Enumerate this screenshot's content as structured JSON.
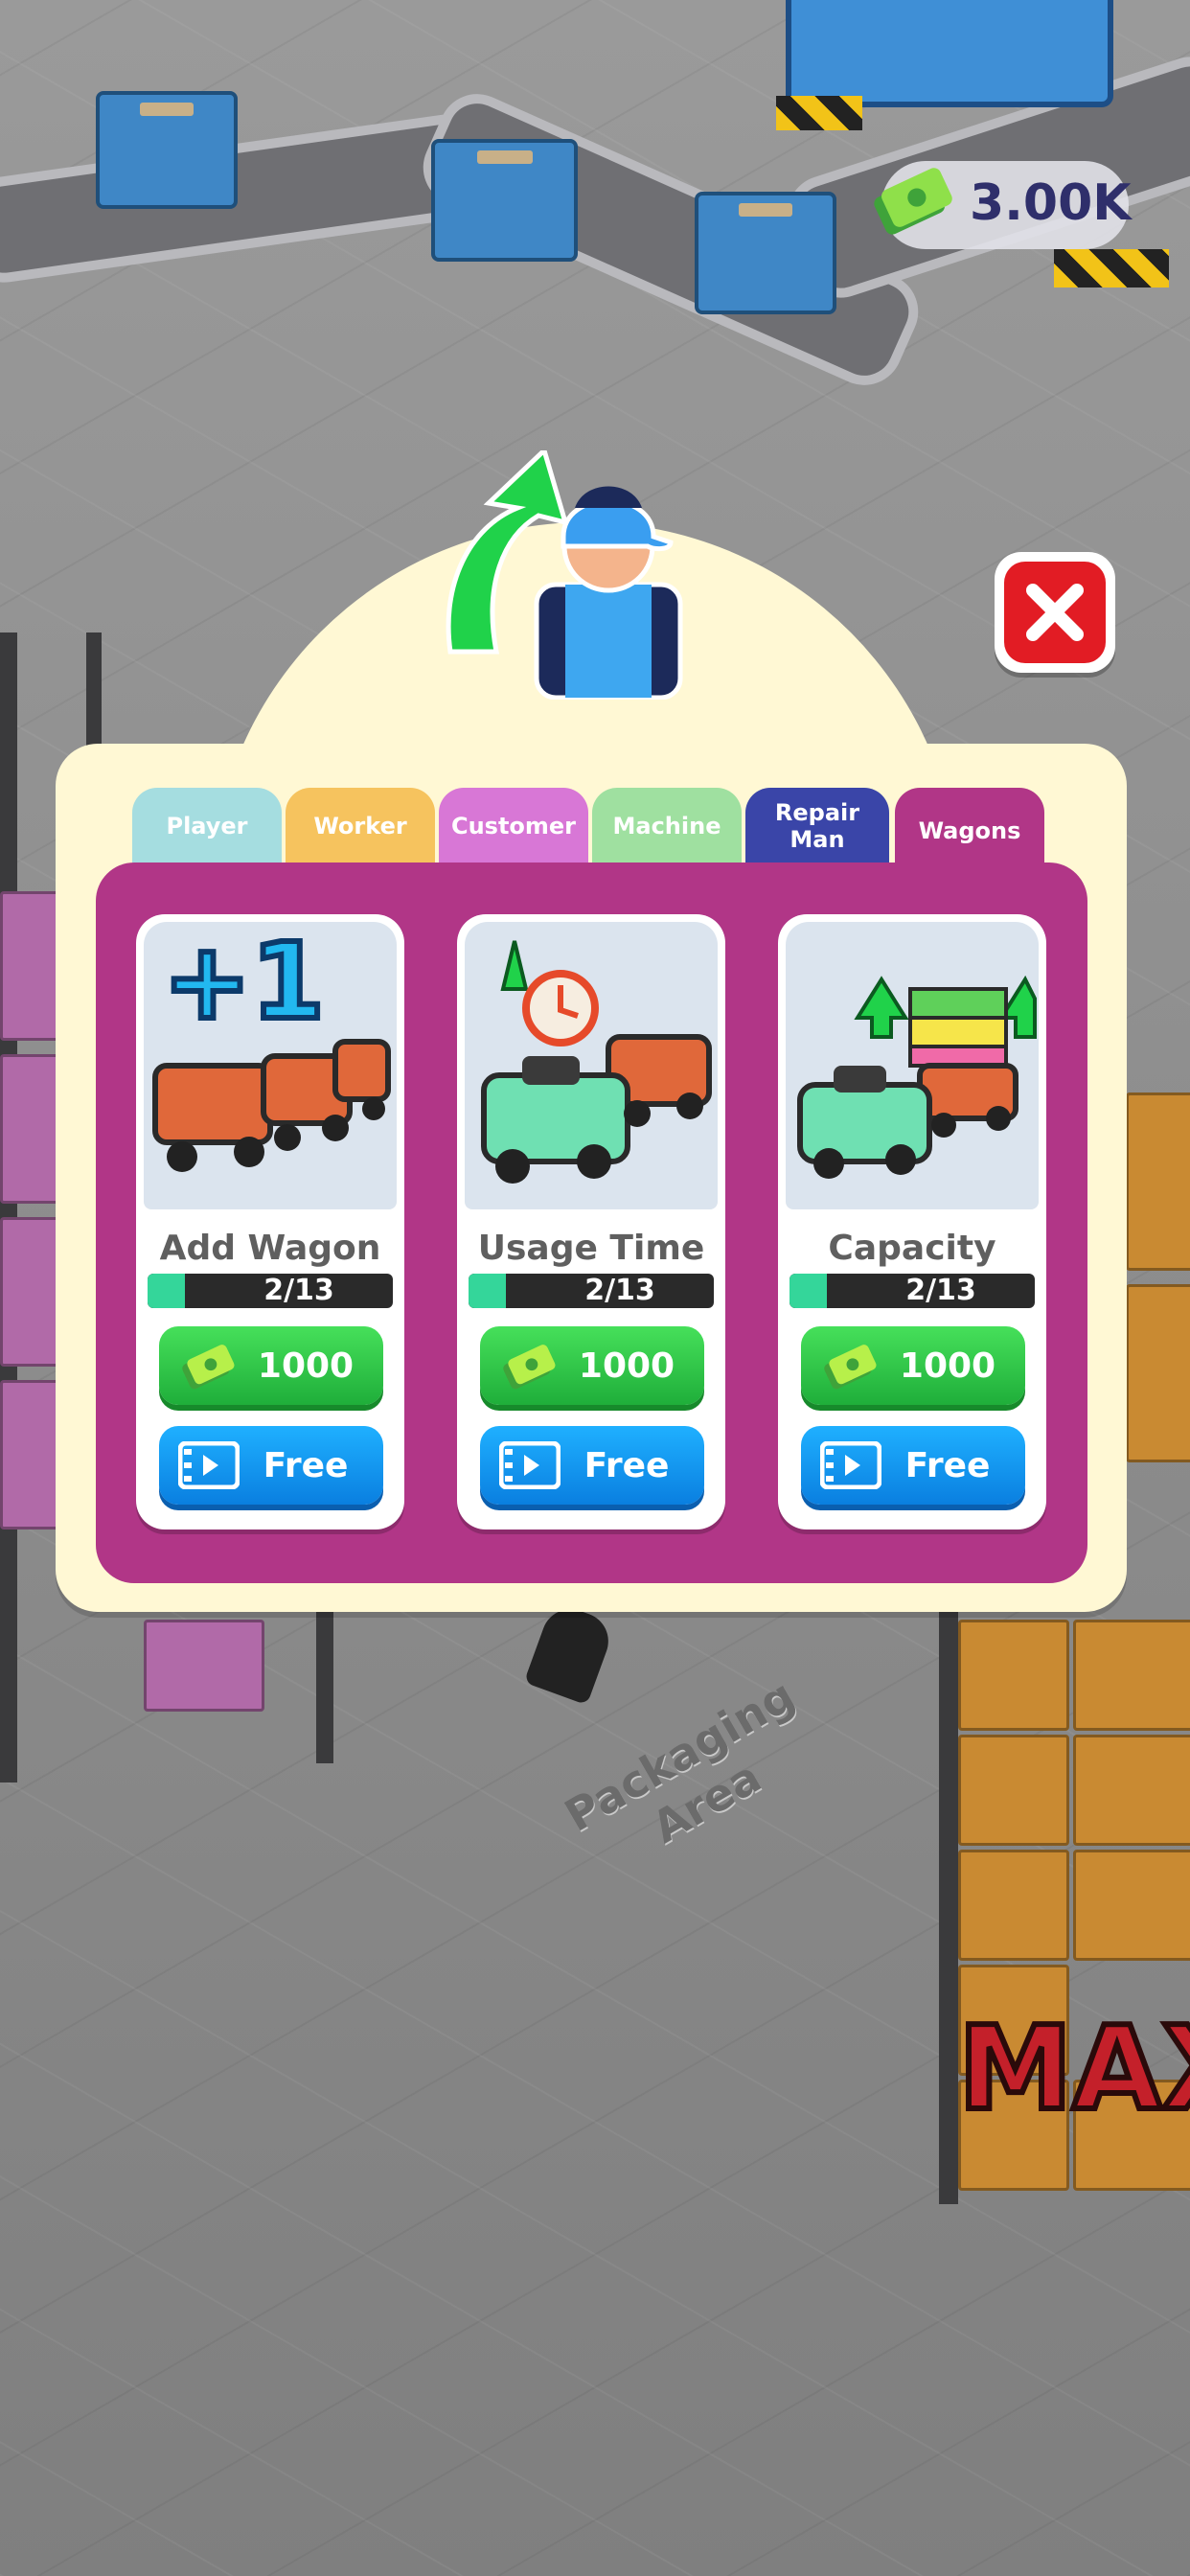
{
  "hud": {
    "money": "3.00K"
  },
  "floor": {
    "area_label_1": "Packaging",
    "area_label_2": "Area",
    "max_label": "MAX"
  },
  "tabs": [
    {
      "label": "Player",
      "color": "#a5dde0"
    },
    {
      "label": "Worker",
      "color": "#f6c35e"
    },
    {
      "label": "Customer",
      "color": "#d877d6"
    },
    {
      "label": "Machine",
      "color": "#9fe0a0"
    },
    {
      "label": "Repair Man",
      "color": "#3a45a8"
    },
    {
      "label": "Wagons",
      "color": "#b13687"
    }
  ],
  "active_tab": "Wagons",
  "cards": [
    {
      "title": "Add Wagon",
      "progress_text": "2/13",
      "progress": 0.154,
      "cost": "1000",
      "free_label": "Free",
      "badge": "+1"
    },
    {
      "title": "Usage Time",
      "progress_text": "2/13",
      "progress": 0.154,
      "cost": "1000",
      "free_label": "Free"
    },
    {
      "title": "Capacity",
      "progress_text": "2/13",
      "progress": 0.154,
      "cost": "1000",
      "free_label": "Free"
    }
  ],
  "colors": {
    "panel_bg": "#fff8d4",
    "content_bg": "#b13687",
    "buy_button": "#2cc548",
    "free_button": "#0f94f0",
    "close_button": "#e21c24"
  },
  "icons": {
    "header": "player-upgrade-icon",
    "close": "close-icon",
    "cost": "cash-stack-icon",
    "free": "video-ad-icon"
  }
}
